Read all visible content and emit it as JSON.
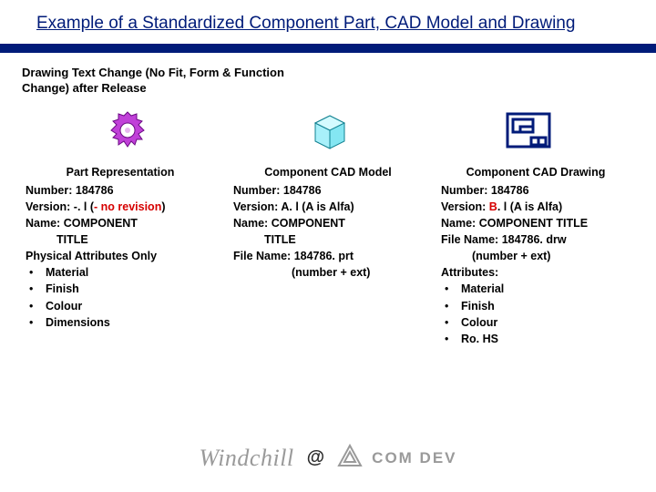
{
  "title": "Example of a Standardized Component Part, CAD Model and Drawing",
  "subtitle": "Drawing Text Change (No Fit, Form & Function Change) after Release",
  "columns": {
    "part": {
      "heading": "Part Representation",
      "number_label": "Number: ",
      "number_value": "184786",
      "version_label": "Version: ",
      "version_value": "-. l (",
      "version_highlight": "- no revision",
      "version_after": ")",
      "name_label": "Name: ",
      "name_value": "COMPONENT",
      "name_line2": "TITLE",
      "sub_label": "Physical Attributes Only",
      "bullets": [
        "Material",
        "Finish",
        "Colour",
        "Dimensions"
      ]
    },
    "model": {
      "heading": "Component CAD Model",
      "number_label": "Number: ",
      "number_value": "184786",
      "version_label": "Version: ",
      "version_value": "A. l (A is Alfa)",
      "name_label": "Name: ",
      "name_value": "COMPONENT",
      "name_line2": "TITLE",
      "file_label": "File Name: ",
      "file_value": "184786. prt",
      "file_line2": "(number + ext)"
    },
    "drawing": {
      "heading": "Component CAD Drawing",
      "number_label": "Number: ",
      "number_value": "184786",
      "version_label": "Version: ",
      "version_value_b": "B",
      "version_value_rest": ". l (A is Alfa)",
      "name_label": "Name: ",
      "name_value": "COMPONENT TITLE",
      "file_label": "File Name: ",
      "file_value": "184786. drw",
      "file_line2": "(number + ext)",
      "attr_label": "Attributes:",
      "bullets": [
        "Material",
        "Finish",
        "Colour",
        "Ro. HS"
      ]
    }
  },
  "footer": {
    "brand1": "Windchill",
    "at": "@",
    "brand2": "COM DEV"
  }
}
